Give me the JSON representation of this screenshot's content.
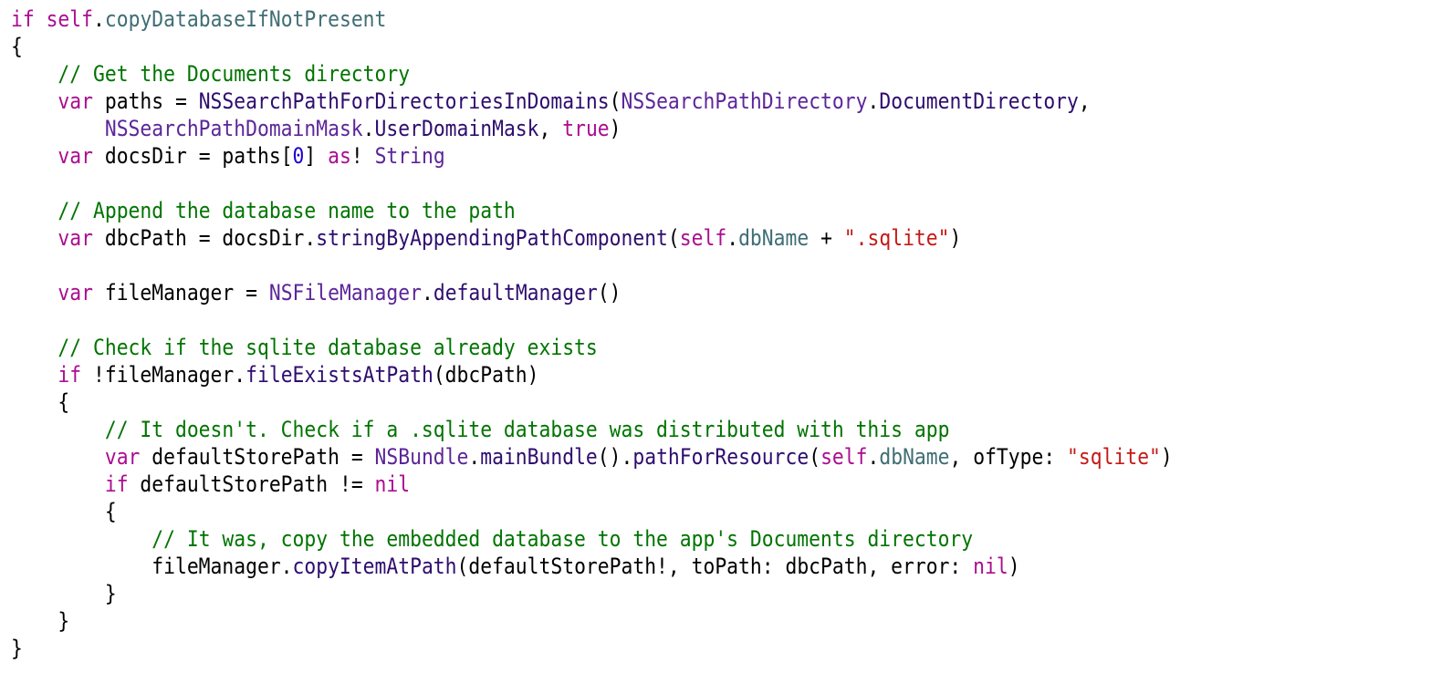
{
  "editor": {
    "language": "swift",
    "token_colors": {
      "kw": "#aa0d91",
      "cm": "#007400",
      "ty": "#5c2699",
      "fn": "#2e0d6e",
      "pr": "#3f6e74",
      "st": "#c41a16",
      "nm": "#1c00cf",
      "pl": "#000000"
    },
    "lines": [
      [
        [
          "kw",
          "if "
        ],
        [
          "kw",
          "self"
        ],
        [
          "pl",
          "."
        ],
        [
          "pr",
          "copyDatabaseIfNotPresent"
        ]
      ],
      [
        [
          "pl",
          "{"
        ]
      ],
      [
        [
          "pl",
          "    "
        ],
        [
          "cm",
          "// Get the Documents directory"
        ]
      ],
      [
        [
          "pl",
          "    "
        ],
        [
          "kw",
          "var"
        ],
        [
          "pl",
          " paths = "
        ],
        [
          "fn",
          "NSSearchPathForDirectoriesInDomains"
        ],
        [
          "pl",
          "("
        ],
        [
          "ty",
          "NSSearchPathDirectory"
        ],
        [
          "pl",
          "."
        ],
        [
          "fn",
          "DocumentDirectory"
        ],
        [
          "pl",
          ","
        ]
      ],
      [
        [
          "pl",
          "        "
        ],
        [
          "ty",
          "NSSearchPathDomainMask"
        ],
        [
          "pl",
          "."
        ],
        [
          "fn",
          "UserDomainMask"
        ],
        [
          "pl",
          ", "
        ],
        [
          "kw",
          "true"
        ],
        [
          "pl",
          ")"
        ]
      ],
      [
        [
          "pl",
          "    "
        ],
        [
          "kw",
          "var"
        ],
        [
          "pl",
          " docsDir = paths["
        ],
        [
          "nm",
          "0"
        ],
        [
          "pl",
          "] "
        ],
        [
          "kw",
          "as"
        ],
        [
          "pl",
          "! "
        ],
        [
          "ty",
          "String"
        ]
      ],
      [],
      [
        [
          "pl",
          "    "
        ],
        [
          "cm",
          "// Append the database name to the path"
        ]
      ],
      [
        [
          "pl",
          "    "
        ],
        [
          "kw",
          "var"
        ],
        [
          "pl",
          " dbcPath = docsDir."
        ],
        [
          "fn",
          "stringByAppendingPathComponent"
        ],
        [
          "pl",
          "("
        ],
        [
          "kw",
          "self"
        ],
        [
          "pl",
          "."
        ],
        [
          "pr",
          "dbName"
        ],
        [
          "pl",
          " + "
        ],
        [
          "st",
          "\".sqlite\""
        ],
        [
          "pl",
          ")"
        ]
      ],
      [],
      [
        [
          "pl",
          "    "
        ],
        [
          "kw",
          "var"
        ],
        [
          "pl",
          " fileManager = "
        ],
        [
          "ty",
          "NSFileManager"
        ],
        [
          "pl",
          "."
        ],
        [
          "fn",
          "defaultManager"
        ],
        [
          "pl",
          "()"
        ]
      ],
      [],
      [
        [
          "pl",
          "    "
        ],
        [
          "cm",
          "// Check if the sqlite database already exists"
        ]
      ],
      [
        [
          "pl",
          "    "
        ],
        [
          "kw",
          "if"
        ],
        [
          "pl",
          " !fileManager."
        ],
        [
          "fn",
          "fileExistsAtPath"
        ],
        [
          "pl",
          "(dbcPath)"
        ]
      ],
      [
        [
          "pl",
          "    {"
        ]
      ],
      [
        [
          "pl",
          "        "
        ],
        [
          "cm",
          "// It doesn't. Check if a .sqlite database was distributed with this app"
        ]
      ],
      [
        [
          "pl",
          "        "
        ],
        [
          "kw",
          "var"
        ],
        [
          "pl",
          " defaultStorePath = "
        ],
        [
          "ty",
          "NSBundle"
        ],
        [
          "pl",
          "."
        ],
        [
          "fn",
          "mainBundle"
        ],
        [
          "pl",
          "()."
        ],
        [
          "fn",
          "pathForResource"
        ],
        [
          "pl",
          "("
        ],
        [
          "kw",
          "self"
        ],
        [
          "pl",
          "."
        ],
        [
          "pr",
          "dbName"
        ],
        [
          "pl",
          ", ofType: "
        ],
        [
          "st",
          "\"sqlite\""
        ],
        [
          "pl",
          ")"
        ]
      ],
      [
        [
          "pl",
          "        "
        ],
        [
          "kw",
          "if"
        ],
        [
          "pl",
          " defaultStorePath != "
        ],
        [
          "kw",
          "nil"
        ]
      ],
      [
        [
          "pl",
          "        {"
        ]
      ],
      [
        [
          "pl",
          "            "
        ],
        [
          "cm",
          "// It was, copy the embedded database to the app's Documents directory"
        ]
      ],
      [
        [
          "pl",
          "            fileManager."
        ],
        [
          "fn",
          "copyItemAtPath"
        ],
        [
          "pl",
          "(defaultStorePath!, toPath: dbcPath, error: "
        ],
        [
          "kw",
          "nil"
        ],
        [
          "pl",
          ")"
        ]
      ],
      [
        [
          "pl",
          "        }"
        ]
      ],
      [
        [
          "pl",
          "    }"
        ]
      ],
      [
        [
          "pl",
          "}"
        ]
      ]
    ]
  }
}
